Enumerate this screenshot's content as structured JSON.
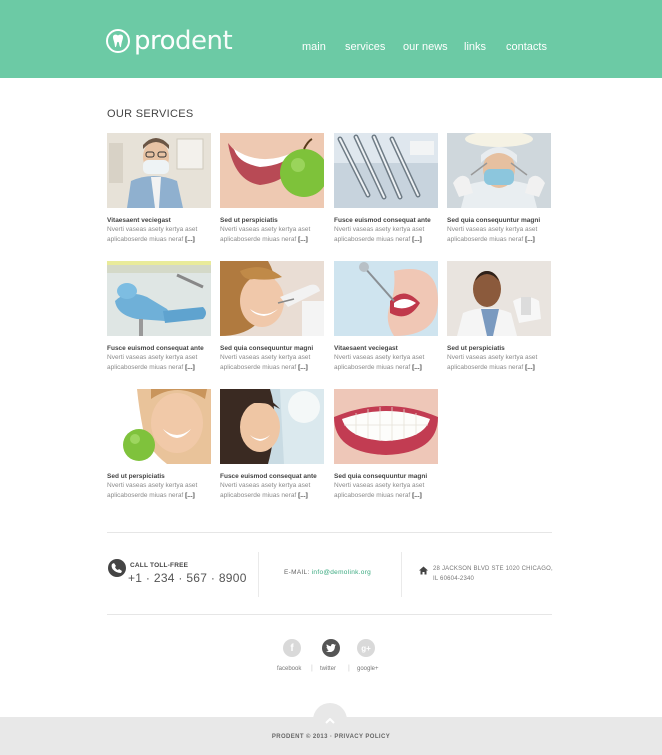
{
  "header": {
    "logo_pro": "pro",
    "logo_dent": "dent",
    "nav": [
      "main",
      "services",
      "our news",
      "links",
      "contacts"
    ]
  },
  "services": {
    "title": "OUR SERVICES",
    "items": [
      {
        "title": "Vitaesaent veciegast",
        "text1": "Nverti vaseas asety kertya aset",
        "text2": "aplicaboserde miuas neraf",
        "more": "[...]"
      },
      {
        "title": "Sed ut perspiciatis",
        "text1": "Nverti vaseas asety kertya aset",
        "text2": "aplicaboserde miuas neraf",
        "more": "[...]"
      },
      {
        "title": "Fusce euismod consequat ante",
        "text1": "Nverti vaseas asety kertya aset",
        "text2": "aplicaboserde miuas neraf",
        "more": "[...]"
      },
      {
        "title": "Sed quia consequuntur magni",
        "text1": "Nverti vaseas asety kertya aset",
        "text2": "aplicaboserde miuas neraf",
        "more": "[...]"
      },
      {
        "title": "Fusce euismod consequat ante",
        "text1": "Nverti vaseas asety kertya aset",
        "text2": "aplicaboserde miuas neraf",
        "more": "[...]"
      },
      {
        "title": "Sed quia consequuntur magni",
        "text1": "Nverti vaseas asety kertya aset",
        "text2": "aplicaboserde miuas neraf",
        "more": "[...]"
      },
      {
        "title": "Vitaesaent veciegast",
        "text1": "Nverti vaseas asety kertya aset",
        "text2": "aplicaboserde miuas neraf",
        "more": "[...]"
      },
      {
        "title": "Sed ut perspiciatis",
        "text1": "Nverti vaseas asety kertya aset",
        "text2": "aplicaboserde miuas neraf",
        "more": "[...]"
      },
      {
        "title": "Sed ut perspiciatis",
        "text1": "Nverti vaseas asety kertya aset",
        "text2": "aplicaboserde miuas neraf",
        "more": "[...]"
      },
      {
        "title": "Fusce euismod consequat ante",
        "text1": "Nverti vaseas asety kertya aset",
        "text2": "aplicaboserde miuas neraf",
        "more": "[...]"
      },
      {
        "title": "Sed quia consequuntur magni",
        "text1": "Nverti vaseas asety kertya aset",
        "text2": "aplicaboserde miuas neraf",
        "more": "[...]"
      }
    ]
  },
  "contact": {
    "call_label": "CALL TOLL-FREE",
    "phone": "+1 · 234 · 567 · 8900",
    "email_label": "E-MAIL:",
    "email": "info@demolink.org",
    "address_line1": "28 JACKSON BLVD STE 1020 CHICAGO,",
    "address_line2": "IL 60604-2340"
  },
  "social": {
    "items": [
      {
        "label": "facebook",
        "icon": "facebook-icon",
        "glyph": "f"
      },
      {
        "label": "twitter",
        "icon": "twitter-icon",
        "glyph": ""
      },
      {
        "label": "google+",
        "icon": "google-plus-icon",
        "glyph": "g+"
      }
    ],
    "separator": "|"
  },
  "footer": {
    "text": "PRODENT © 2013 · PRIVACY POLICY"
  },
  "colors": {
    "brand": "#6ccaa5",
    "link": "#39a97f",
    "footer_bg": "#e8e8e8"
  }
}
